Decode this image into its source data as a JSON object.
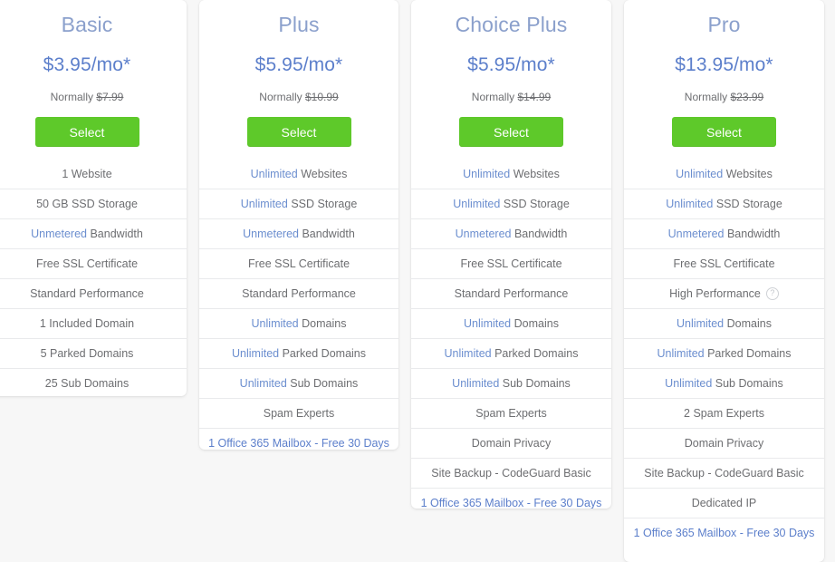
{
  "theme": {
    "page_background": "#f7f7f7",
    "card_background": "#ffffff",
    "plan_name_color": "#8ba0cc",
    "price_color": "#5c7fcb",
    "button_color": "#5ec92a",
    "link_color": "#5c7fcb",
    "highlight_color": "#6b8ecf",
    "text_color": "#6d6e71",
    "divider_color": "#e9eaec"
  },
  "labels": {
    "normally_prefix": "Normally",
    "select": "Select",
    "help_glyph": "?",
    "help_icon_name": "help-tooltip-icon"
  },
  "plans": [
    {
      "name": "Basic",
      "price": "$3.95/mo*",
      "normally_price": "$7.99",
      "select_label": "Select",
      "features": [
        {
          "highlight": "",
          "text": "1 Website",
          "is_link": false,
          "help": false
        },
        {
          "highlight": "",
          "text": "50 GB SSD Storage",
          "is_link": false,
          "help": false
        },
        {
          "highlight": "Unmetered",
          "text": "Bandwidth",
          "is_link": false,
          "help": false
        },
        {
          "highlight": "",
          "text": "Free SSL Certificate",
          "is_link": false,
          "help": false
        },
        {
          "highlight": "",
          "text": "Standard Performance",
          "is_link": false,
          "help": false
        },
        {
          "highlight": "",
          "text": "1 Included Domain",
          "is_link": false,
          "help": false
        },
        {
          "highlight": "",
          "text": "5 Parked Domains",
          "is_link": false,
          "help": false
        },
        {
          "highlight": "",
          "text": "25 Sub Domains",
          "is_link": false,
          "help": false
        }
      ]
    },
    {
      "name": "Plus",
      "price": "$5.95/mo*",
      "normally_price": "$10.99",
      "select_label": "Select",
      "features": [
        {
          "highlight": "Unlimited",
          "text": "Websites",
          "is_link": false,
          "help": false
        },
        {
          "highlight": "Unlimited",
          "text": "SSD Storage",
          "is_link": false,
          "help": false
        },
        {
          "highlight": "Unmetered",
          "text": "Bandwidth",
          "is_link": false,
          "help": false
        },
        {
          "highlight": "",
          "text": "Free SSL Certificate",
          "is_link": false,
          "help": false
        },
        {
          "highlight": "",
          "text": "Standard Performance",
          "is_link": false,
          "help": false
        },
        {
          "highlight": "Unlimited",
          "text": "Domains",
          "is_link": false,
          "help": false
        },
        {
          "highlight": "Unlimited",
          "text": "Parked Domains",
          "is_link": false,
          "help": false
        },
        {
          "highlight": "Unlimited",
          "text": "Sub Domains",
          "is_link": false,
          "help": false
        },
        {
          "highlight": "",
          "text": "Spam Experts",
          "is_link": false,
          "help": false
        },
        {
          "highlight": "",
          "text": "1 Office 365 Mailbox - Free 30 Days",
          "is_link": true,
          "help": false
        }
      ]
    },
    {
      "name": "Choice Plus",
      "price": "$5.95/mo*",
      "normally_price": "$14.99",
      "select_label": "Select",
      "features": [
        {
          "highlight": "Unlimited",
          "text": "Websites",
          "is_link": false,
          "help": false
        },
        {
          "highlight": "Unlimited",
          "text": "SSD Storage",
          "is_link": false,
          "help": false
        },
        {
          "highlight": "Unmetered",
          "text": "Bandwidth",
          "is_link": false,
          "help": false
        },
        {
          "highlight": "",
          "text": "Free SSL Certificate",
          "is_link": false,
          "help": false
        },
        {
          "highlight": "",
          "text": "Standard Performance",
          "is_link": false,
          "help": false
        },
        {
          "highlight": "Unlimited",
          "text": "Domains",
          "is_link": false,
          "help": false
        },
        {
          "highlight": "Unlimited",
          "text": "Parked Domains",
          "is_link": false,
          "help": false
        },
        {
          "highlight": "Unlimited",
          "text": "Sub Domains",
          "is_link": false,
          "help": false
        },
        {
          "highlight": "",
          "text": "Spam Experts",
          "is_link": false,
          "help": false
        },
        {
          "highlight": "",
          "text": "Domain Privacy",
          "is_link": false,
          "help": false
        },
        {
          "highlight": "",
          "text": "Site Backup - CodeGuard Basic",
          "is_link": false,
          "help": false
        },
        {
          "highlight": "",
          "text": "1 Office 365 Mailbox - Free 30 Days",
          "is_link": true,
          "help": false
        }
      ]
    },
    {
      "name": "Pro",
      "price": "$13.95/mo*",
      "normally_price": "$23.99",
      "select_label": "Select",
      "features": [
        {
          "highlight": "Unlimited",
          "text": "Websites",
          "is_link": false,
          "help": false
        },
        {
          "highlight": "Unlimited",
          "text": "SSD Storage",
          "is_link": false,
          "help": false
        },
        {
          "highlight": "Unmetered",
          "text": "Bandwidth",
          "is_link": false,
          "help": false
        },
        {
          "highlight": "",
          "text": "Free SSL Certificate",
          "is_link": false,
          "help": false
        },
        {
          "highlight": "",
          "text": "High Performance",
          "is_link": false,
          "help": true
        },
        {
          "highlight": "Unlimited",
          "text": "Domains",
          "is_link": false,
          "help": false
        },
        {
          "highlight": "Unlimited",
          "text": "Parked Domains",
          "is_link": false,
          "help": false
        },
        {
          "highlight": "Unlimited",
          "text": "Sub Domains",
          "is_link": false,
          "help": false
        },
        {
          "highlight": "",
          "text": "2 Spam Experts",
          "is_link": false,
          "help": false
        },
        {
          "highlight": "",
          "text": "Domain Privacy",
          "is_link": false,
          "help": false
        },
        {
          "highlight": "",
          "text": "Site Backup - CodeGuard Basic",
          "is_link": false,
          "help": false
        },
        {
          "highlight": "",
          "text": "Dedicated IP",
          "is_link": false,
          "help": false
        },
        {
          "highlight": "",
          "text": "1 Office 365 Mailbox - Free 30 Days",
          "is_link": true,
          "help": false
        }
      ]
    }
  ]
}
